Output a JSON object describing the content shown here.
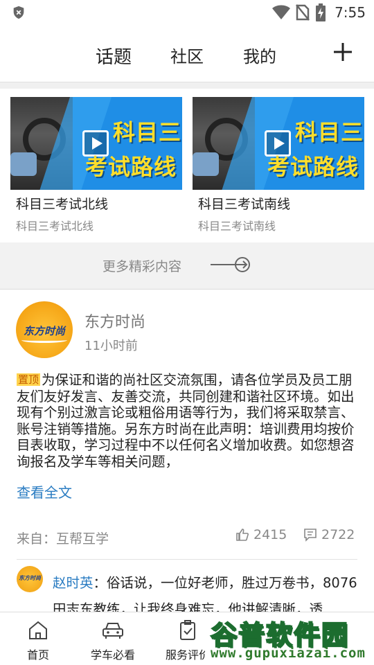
{
  "status_bar": {
    "time": "7:55",
    "icons": [
      "shield-icon",
      "wifi-icon",
      "no-sim-icon",
      "battery-charging-icon"
    ]
  },
  "top_nav": {
    "tabs": [
      {
        "label": "话题",
        "active": true
      },
      {
        "label": "社区",
        "active": false
      },
      {
        "label": "我的",
        "active": false
      }
    ],
    "add_icon": "plus-icon"
  },
  "videos": [
    {
      "thumb_line1": "科目三",
      "thumb_line2": "考试路线",
      "title": "科目三考试北线",
      "subtitle": "科目三考试北线"
    },
    {
      "thumb_line1": "科目三",
      "thumb_line2": "考试路线",
      "title": "科目三考试南线",
      "subtitle": "科目三考试南线"
    }
  ],
  "more": {
    "label": "更多精彩内容"
  },
  "post": {
    "avatar_text": "东方时尚",
    "author": "东方时尚",
    "time": "11小时前",
    "pin_label": "置顶",
    "body": "为保证和谐的尚社区交流氛围，请各位学员及员工朋友们友好发言、友善交流，共同创建和谐社区环境。如出现有个别过激言论或粗俗用语等行为，我们将采取禁言、账号注销等措施。另东方时尚在此声明：培训费用均按价目表收取，学习过程中不以任何名义增加收费。如您想咨询报名及学车等相关问题，",
    "read_more": "查看全文",
    "source": "来自：互帮互学",
    "likes": "2415",
    "comments": "2722"
  },
  "comment": {
    "avatar_text": "东方时尚",
    "name": "赵时英",
    "text": "：俗话说，一位好老师，胜过万卷书，8076田志东教练，让我终身难忘，他讲解清晰，透"
  },
  "bottom_nav": [
    {
      "label": "首页",
      "icon": "home-icon"
    },
    {
      "label": "学车必看",
      "icon": "car-icon"
    },
    {
      "label": "服务评价",
      "icon": "clipboard-check-icon"
    }
  ],
  "watermark": {
    "line1_a": "谷普",
    "line1_b": "软件园",
    "line2": "www.gupuxiazai.com"
  },
  "colors": {
    "accent_blue": "#2a7cc2",
    "pin_yellow": "#ffd34d",
    "thumb_blue": "#1f8ee6",
    "title_yellow": "#ffde2a"
  }
}
